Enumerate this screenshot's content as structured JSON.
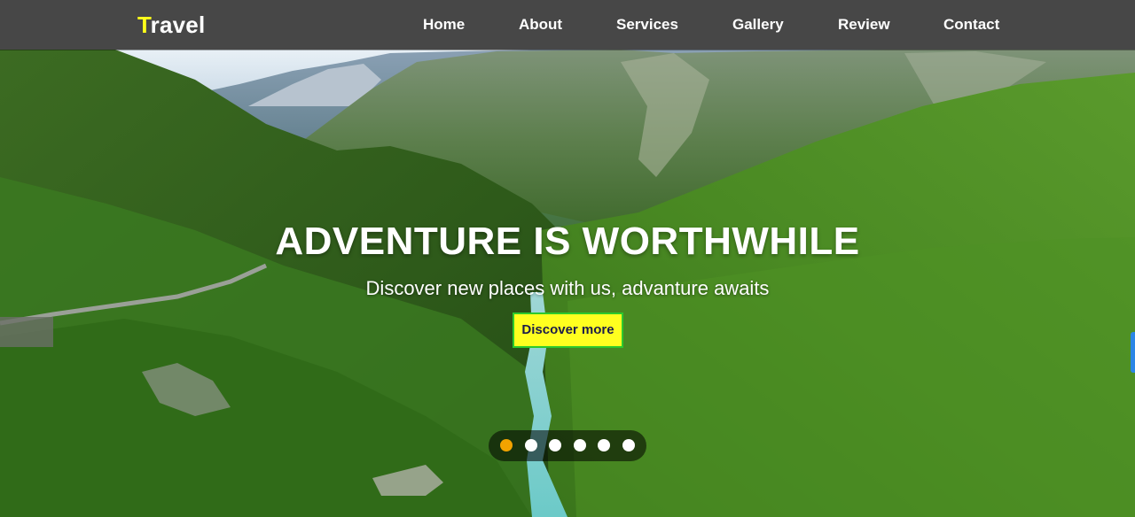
{
  "navbar": {
    "logo_first_letter": "T",
    "logo_rest": "ravel",
    "links": [
      {
        "label": "Home"
      },
      {
        "label": "About"
      },
      {
        "label": "Services"
      },
      {
        "label": "Gallery"
      },
      {
        "label": "Review"
      },
      {
        "label": "Contact"
      }
    ]
  },
  "hero": {
    "title": "ADVENTURE IS WORTHWHILE",
    "subtitle": "Discover new places with us, advanture awaits",
    "cta_label": "Discover more",
    "background_image": "mountain-valley-river"
  },
  "slider": {
    "total": 6,
    "active_index": 0
  },
  "colors": {
    "navbar_bg": "#474747",
    "logo_accent": "#ffff1a",
    "cta_bg": "#ffff1f",
    "cta_border": "#2cc92c",
    "active_dot": "#f2a300",
    "side_tab": "#2b86e6"
  }
}
